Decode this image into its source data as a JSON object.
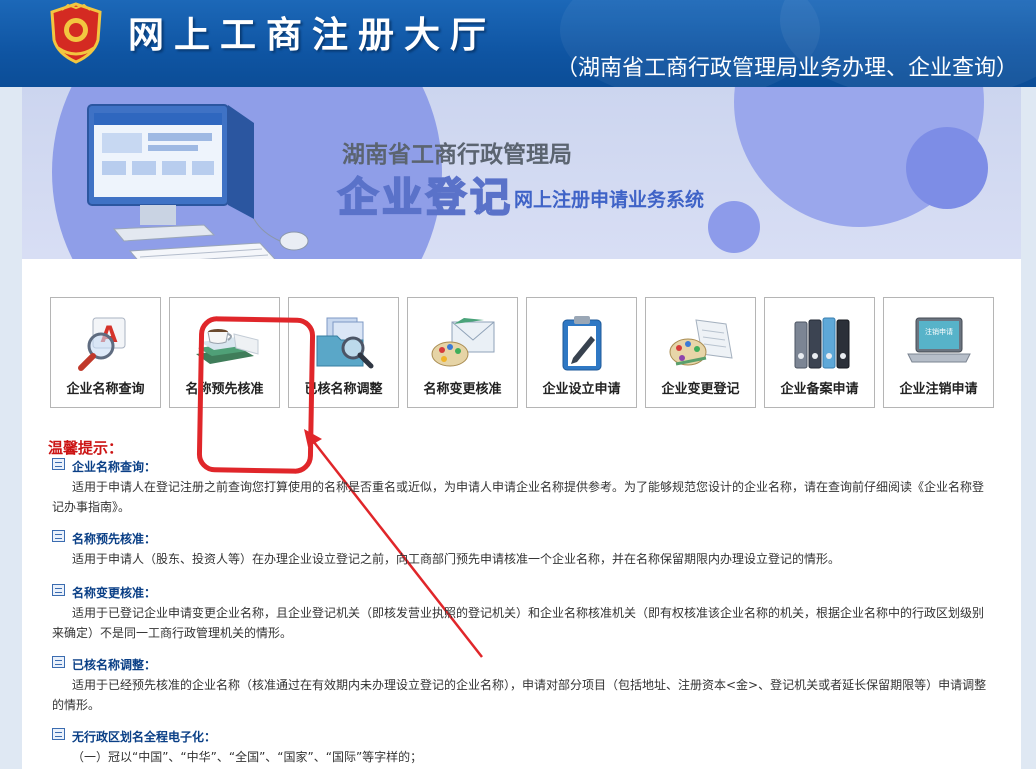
{
  "header": {
    "title": "网上工商注册大厅",
    "subtitle": "（湖南省工商行政管理局业务办理、企业查询）"
  },
  "banner": {
    "line1": "湖南省工商行政管理局",
    "big": "企业登记",
    "line2": "网上注册申请业务系统"
  },
  "tiles": [
    {
      "label": "企业名称查询",
      "icon": "search-name-icon"
    },
    {
      "label": "名称预先核准",
      "icon": "books-cup-icon"
    },
    {
      "label": "已核名称调整",
      "icon": "folder-magnifier-icon"
    },
    {
      "label": "名称变更核准",
      "icon": "envelope-palette-icon"
    },
    {
      "label": "企业设立申请",
      "icon": "clipboard-pen-icon"
    },
    {
      "label": "企业变更登记",
      "icon": "palette-doc-icon"
    },
    {
      "label": "企业备案申请",
      "icon": "binders-icon"
    },
    {
      "label": "企业注销申请",
      "icon": "laptop-cancel-icon"
    }
  ],
  "laptop_screen_text": "注销申请",
  "tips": {
    "title": "温馨提示：",
    "items": [
      {
        "head": "企业名称查询：",
        "body": "适用于申请人在登记注册之前查询您打算使用的名称是否重名或近似，为申请人申请企业名称提供参考。为了能够规范您设计的企业名称，请在查询前仔细阅读《企业名称登记办事指南》。"
      },
      {
        "head": "名称预先核准：",
        "body": "适用于申请人（股东、投资人等）在办理企业设立登记之前，向工商部门预先申请核准一个企业名称，并在名称保留期限内办理设立登记的情形。"
      },
      {
        "head": "名称变更核准：",
        "body": "适用于已登记企业申请变更企业名称，且企业登记机关（即核发营业执照的登记机关）和企业名称核准机关（即有权核准该企业名称的机关，根据企业名称中的行政区划级别来确定）不是同一工商行政管理机关的情形。"
      },
      {
        "head": "已核名称调整：",
        "body": "适用于已经预先核准的企业名称（核准通过在有效期内未办理设立登记的企业名称），申请对部分项目（包括地址、注册资本<金>、登记机关或者延长保留期限等）申请调整的情形。"
      },
      {
        "head": "无行政区划名全程电子化：",
        "body": "（一）冠以“中国”、“中华”、“全国”、“国家”、“国际”等字样的；"
      }
    ]
  },
  "colors": {
    "header_blue": "#0f55a3",
    "highlight_red": "#e0262a",
    "tips_title_red": "#cc1414",
    "tip_head_blue": "#0a3f86"
  }
}
